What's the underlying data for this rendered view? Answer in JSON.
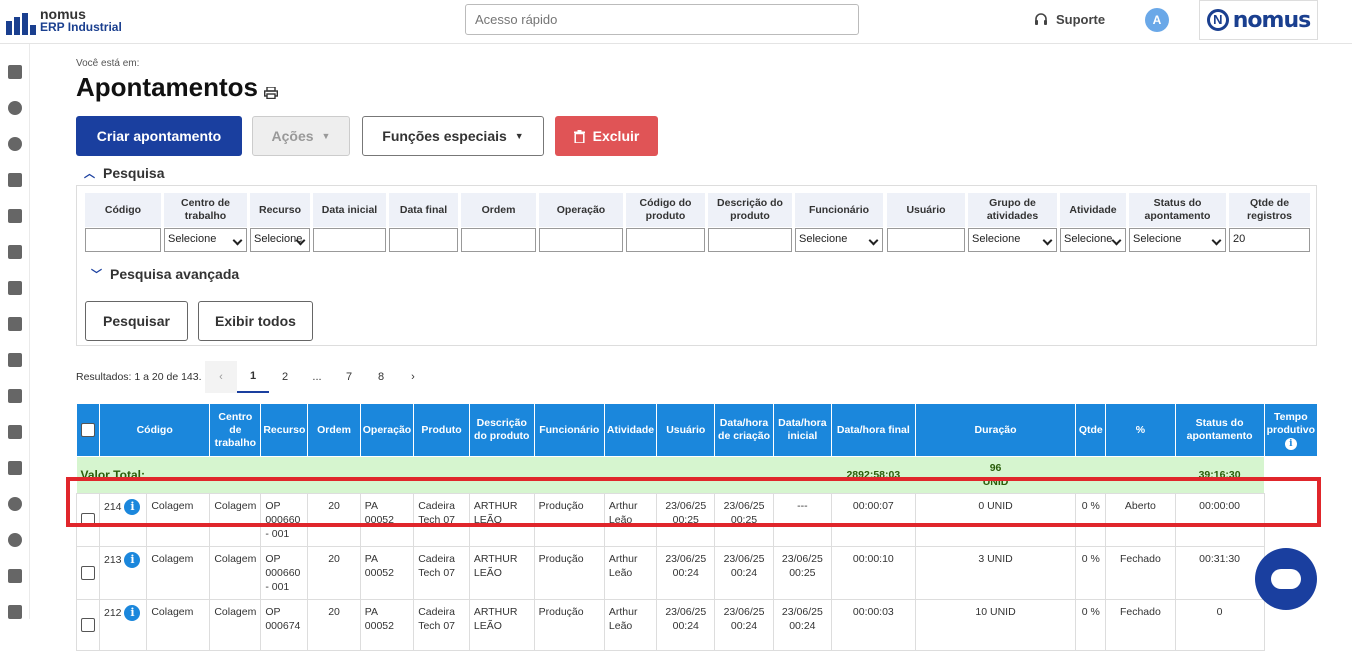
{
  "header": {
    "logo_line1": "nomus",
    "logo_line2": "ERP Industrial",
    "search_placeholder": "Acesso rápido",
    "support_label": "Suporte",
    "avatar_initial": "A",
    "brand_text": "nomus",
    "brand_letter": "N"
  },
  "page": {
    "breadcrumb": "Você está em:",
    "title": "Apontamentos"
  },
  "toolbar": {
    "create_label": "Criar apontamento",
    "actions_label": "Ações",
    "special_label": "Funções especiais",
    "delete_label": "Excluir"
  },
  "filters": {
    "section_label": "Pesquisa",
    "advanced_label": "Pesquisa avançada",
    "columns": [
      "Código",
      "Centro de trabalho",
      "Recurso",
      "Data inicial",
      "Data final",
      "Ordem",
      "Operação",
      "Código do produto",
      "Descrição do produto",
      "Funcionário",
      "Usuário",
      "Grupo de atividades",
      "Atividade",
      "Status do apontamento",
      "Qtde de registros"
    ],
    "values": [
      "",
      "Selecione",
      "Selecione",
      "",
      "",
      "",
      "",
      "",
      "",
      "Selecione",
      "",
      "Selecione",
      "Selecione",
      "Selecione",
      "20"
    ],
    "search_button": "Pesquisar",
    "show_all_button": "Exibir todos"
  },
  "pagination": {
    "results_text": "Resultados: 1 a 20 de 143.",
    "prev": "‹",
    "pages": [
      "1",
      "2",
      "...",
      "7",
      "8"
    ],
    "next": "›",
    "current": "1"
  },
  "table": {
    "headers": [
      "Código",
      "Centro de trabalho",
      "Recurso",
      "Ordem",
      "Operação",
      "Produto",
      "Descrição do produto",
      "Funcionário",
      "Atividade",
      "Usuário",
      "Data/hora de criação",
      "Data/hora inicial",
      "Data/hora final",
      "Duração",
      "Qtde",
      "%",
      "Status do apontamento",
      "Tempo produtivo"
    ],
    "total": {
      "label": "Valor Total:",
      "duration": "2892:58:03",
      "qty": "96",
      "unit": "UNID",
      "productive": "39:16:30"
    },
    "rows": [
      {
        "code": "214",
        "center": "Colagem",
        "resource": "Colagem",
        "order": "OP 000660 - 001",
        "operation": "20",
        "product": "PA 00052",
        "description": "Cadeira Tech 07",
        "employee": "ARTHUR LEÃO",
        "activity": "Produção",
        "user": "Arthur Leão",
        "created": "23/06/25 00:25",
        "start": "23/06/25 00:25",
        "end": "---",
        "duration": "00:00:07",
        "qty": "0 UNID",
        "pct": "0 %",
        "status": "Aberto",
        "productive": "00:00:00"
      },
      {
        "code": "213",
        "center": "Colagem",
        "resource": "Colagem",
        "order": "OP 000660 - 001",
        "operation": "20",
        "product": "PA 00052",
        "description": "Cadeira Tech 07",
        "employee": "ARTHUR LEÃO",
        "activity": "Produção",
        "user": "Arthur Leão",
        "created": "23/06/25 00:24",
        "start": "23/06/25 00:24",
        "end": "23/06/25 00:25",
        "duration": "00:00:10",
        "qty": "3 UNID",
        "pct": "0 %",
        "status": "Fechado",
        "productive": "00:31:30"
      },
      {
        "code": "212",
        "center": "Colagem",
        "resource": "Colagem",
        "order": "OP 000674",
        "operation": "20",
        "product": "PA 00052",
        "description": "Cadeira Tech 07",
        "employee": "ARTHUR LEÃO",
        "activity": "Produção",
        "user": "Arthur Leão",
        "created": "23/06/25 00:24",
        "start": "23/06/25 00:24",
        "end": "23/06/25 00:24",
        "duration": "00:00:03",
        "qty": "10 UNID",
        "pct": "0 %",
        "status": "Fechado",
        "productive": "0"
      }
    ]
  },
  "colors": {
    "primary": "#1a3f9f",
    "header_blue": "#1b87dc",
    "danger": "#e05456",
    "total_bg": "#d6f5cf",
    "highlight": "#e0262b"
  }
}
